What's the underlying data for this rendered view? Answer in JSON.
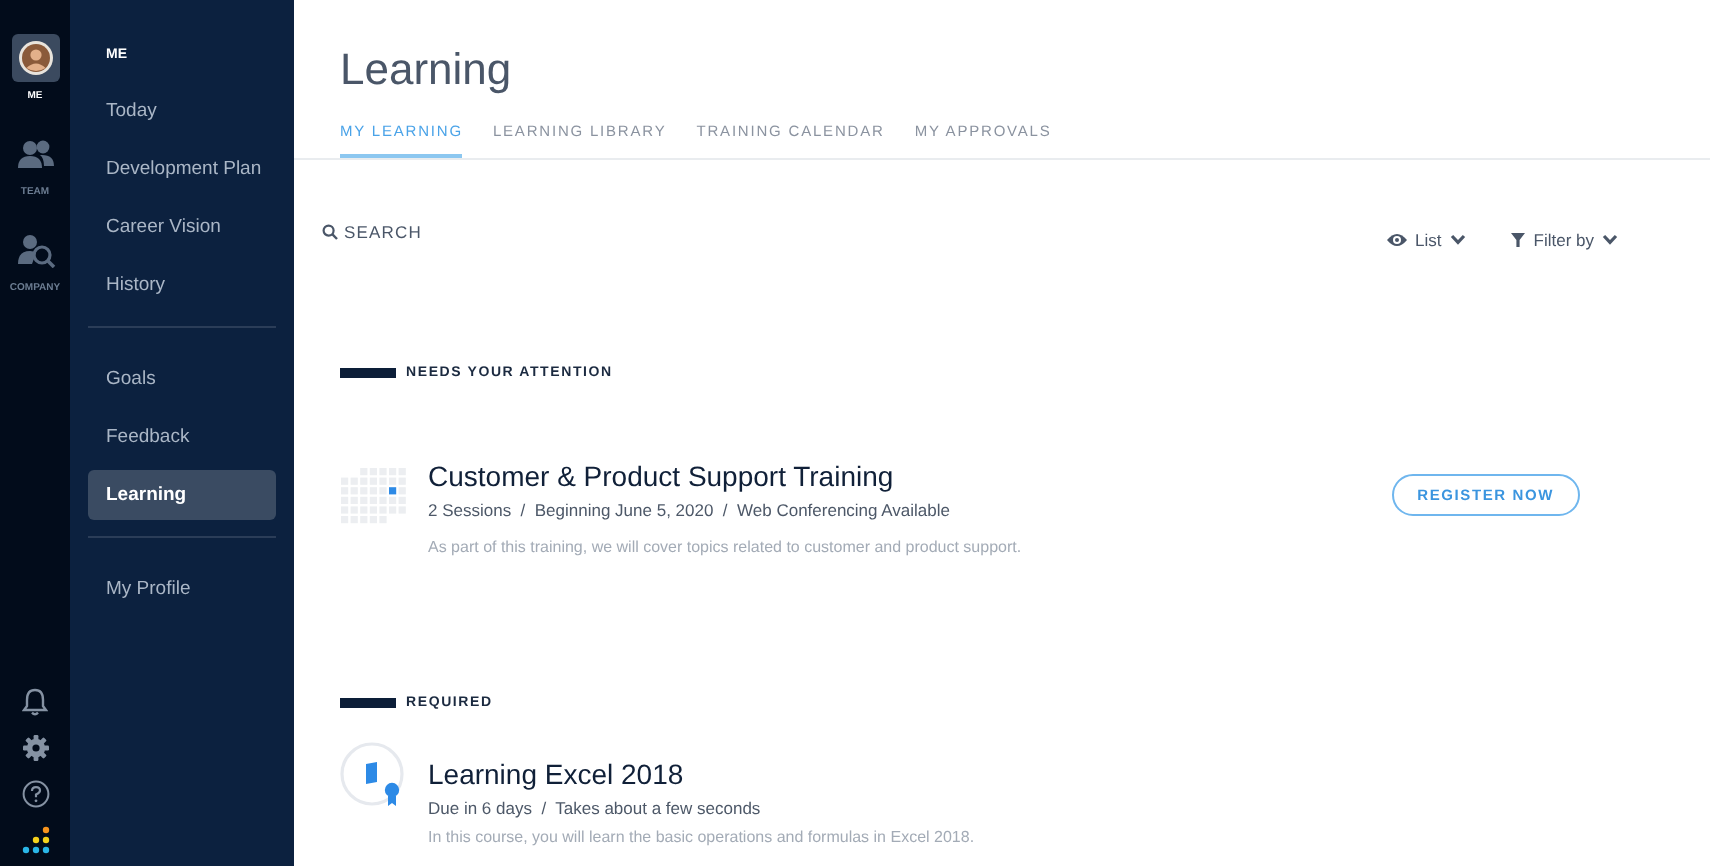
{
  "rail": {
    "items": [
      {
        "label": "ME",
        "selected": true
      },
      {
        "label": "TEAM",
        "selected": false
      },
      {
        "label": "COMPANY",
        "selected": false
      }
    ]
  },
  "sidebar": {
    "heading": "ME",
    "groups": [
      [
        {
          "label": "Today",
          "selected": false
        },
        {
          "label": "Development Plan",
          "selected": false
        },
        {
          "label": "Career Vision",
          "selected": false
        },
        {
          "label": "History",
          "selected": false
        }
      ],
      [
        {
          "label": "Goals",
          "selected": false
        },
        {
          "label": "Feedback",
          "selected": false
        },
        {
          "label": "Learning",
          "selected": true
        }
      ],
      [
        {
          "label": "My Profile",
          "selected": false
        }
      ]
    ]
  },
  "page": {
    "title": "Learning"
  },
  "tabs": [
    {
      "label": "MY LEARNING",
      "selected": true
    },
    {
      "label": "LEARNING LIBRARY",
      "selected": false
    },
    {
      "label": "TRAINING CALENDAR",
      "selected": false
    },
    {
      "label": "MY APPROVALS",
      "selected": false
    }
  ],
  "toolbar": {
    "search": "SEARCH",
    "view": "List",
    "filter": "Filter by"
  },
  "sections": [
    {
      "heading": "NEEDS YOUR ATTENTION",
      "items": [
        {
          "kind": "event",
          "title": "Customer & Product Support Training",
          "meta": "2 Sessions  /  Beginning June 5, 2020  /  Web Conferencing Available",
          "description": "As part of this training, we will cover topics related to customer and product support.",
          "action": "REGISTER NOW"
        }
      ]
    },
    {
      "heading": "REQUIRED",
      "items": [
        {
          "kind": "course",
          "title": "Learning Excel 2018",
          "meta": "Due in 6 days  /  Takes about a few seconds",
          "description": "In this course, you will learn the basic operations and formulas in Excel 2018."
        }
      ]
    }
  ]
}
